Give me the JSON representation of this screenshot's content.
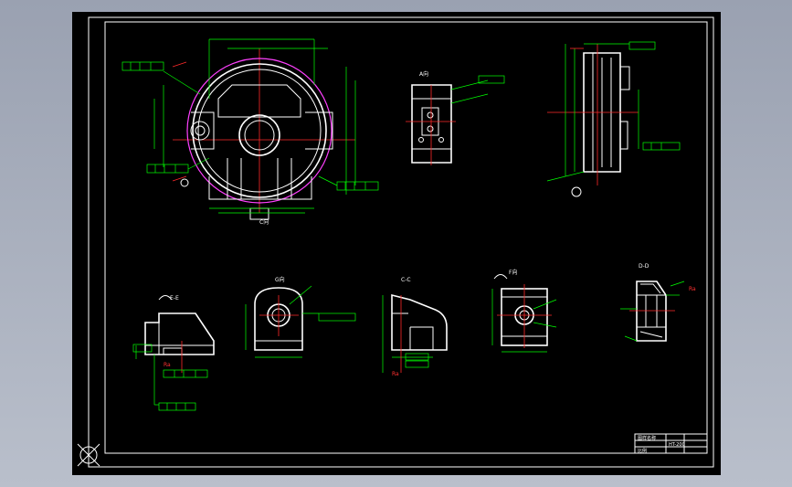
{
  "views": {
    "a_view_title": "A向",
    "e_view_title": "E-E",
    "g_view_title": "G向",
    "c_view_title": "C-C",
    "f_view_title": "F向",
    "d_view_title": "D-D"
  },
  "title_block": {
    "row1": "图样名称",
    "row2": "HT-200",
    "row3": "比例"
  },
  "colors": {
    "sheet": "#000000",
    "outline": "#ffffff",
    "dimension": "#00ff00",
    "center_line": "#ff2a2a",
    "hidden": "#ff40ff"
  }
}
